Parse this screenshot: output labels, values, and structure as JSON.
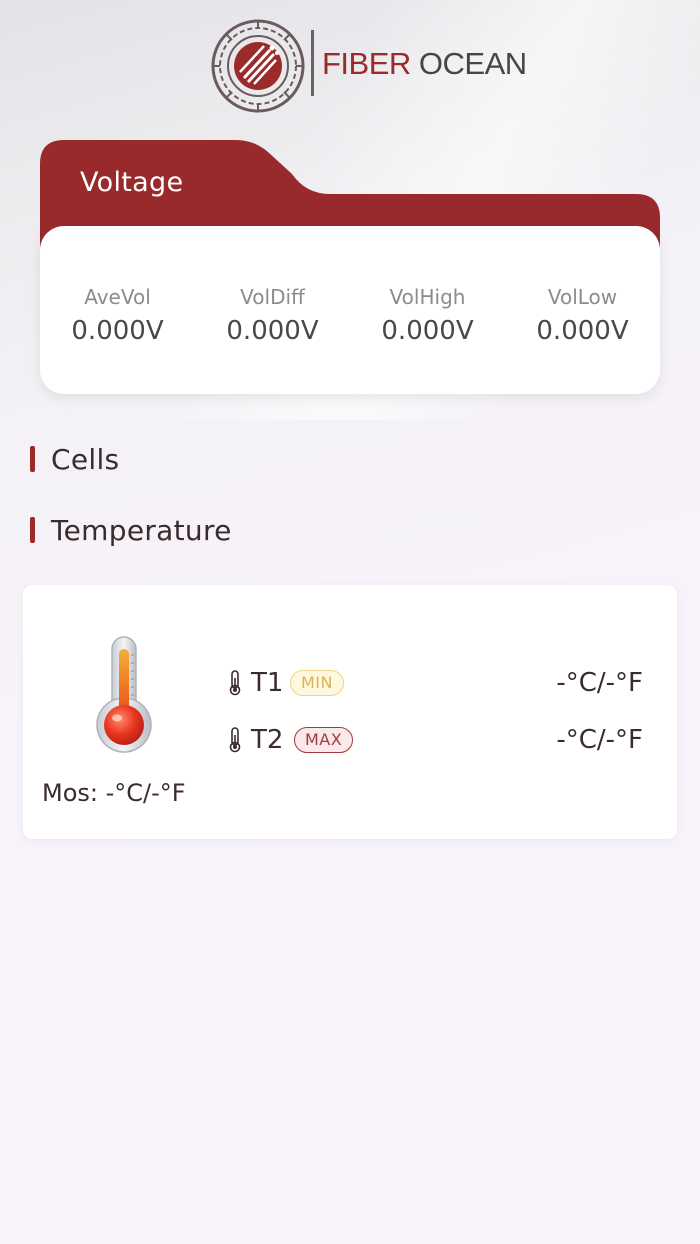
{
  "brand": {
    "name_part1": "FIBER",
    "name_part2": "OCEAN",
    "primary_color": "#9b2b2b"
  },
  "voltage": {
    "title": "Voltage",
    "metrics": [
      {
        "label": "AveVol",
        "value": "0.000V"
      },
      {
        "label": "VolDiff",
        "value": "0.000V"
      },
      {
        "label": "VolHigh",
        "value": "0.000V"
      },
      {
        "label": "VolLow",
        "value": "0.000V"
      }
    ]
  },
  "sections": {
    "cells_title": "Cells",
    "temperature_title": "Temperature"
  },
  "temperature": {
    "mos": "Mos: -°C/-°F",
    "sensors": [
      {
        "name": "T1",
        "badge": "MIN",
        "value": "-°C/-°F",
        "badge_color": "#dbb452"
      },
      {
        "name": "T2",
        "badge": "MAX",
        "value": "-°C/-°F",
        "badge_color": "#a3393a"
      }
    ],
    "icons": {
      "thermometer_large": "thermometer-icon",
      "thermometer_small": "thermometer-small-icon"
    }
  }
}
